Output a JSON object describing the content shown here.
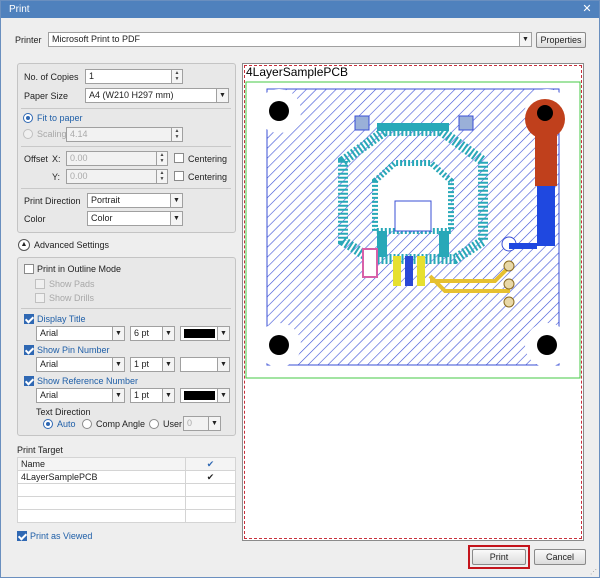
{
  "window": {
    "title": "Print"
  },
  "printer": {
    "label": "Printer",
    "value": "Microsoft Print to PDF",
    "properties_label": "Properties"
  },
  "settings": {
    "copies_label": "No. of Copies",
    "copies_value": "1",
    "paper_size_label": "Paper Size",
    "paper_size_value": "A4 (W210 H297 mm)",
    "fit_to_paper_label": "Fit to paper",
    "scaling_label": "Scaling",
    "scaling_value": "4.14",
    "offset_label": "Offset",
    "x_label": "X:",
    "x_value": "0.00",
    "y_label": "Y:",
    "y_value": "0.00",
    "centering_label": "Centering",
    "direction_label": "Print Direction",
    "direction_value": "Portrait",
    "color_label": "Color",
    "color_value": "Color"
  },
  "advanced": {
    "header_label": "Advanced Settings",
    "outline_label": "Print in Outline Mode",
    "show_pads_label": "Show Pads",
    "show_drills_label": "Show Drills",
    "display_title": {
      "label": "Display Title",
      "font": "Arial",
      "size": "6 pt",
      "color": "#000000"
    },
    "show_pin_number": {
      "label": "Show Pin Number",
      "font": "Arial",
      "size": "1 pt",
      "color": "#ffffff"
    },
    "show_reference_number": {
      "label": "Show Reference Number",
      "font": "Arial",
      "size": "1 pt",
      "color": "#000000"
    },
    "text_direction_label": "Text Direction",
    "auto_label": "Auto",
    "comp_angle_label": "Comp Angle",
    "user_label": "User",
    "user_value": "0"
  },
  "print_target": {
    "label": "Print Target",
    "column_name": "Name",
    "rows": [
      {
        "name": "4LayerSamplePCB",
        "checked": true
      }
    ]
  },
  "print_as_viewed_label": "Print as Viewed",
  "preview": {
    "title": "4LayerSamplePCB"
  },
  "footer": {
    "print_label": "Print",
    "cancel_label": "Cancel"
  }
}
